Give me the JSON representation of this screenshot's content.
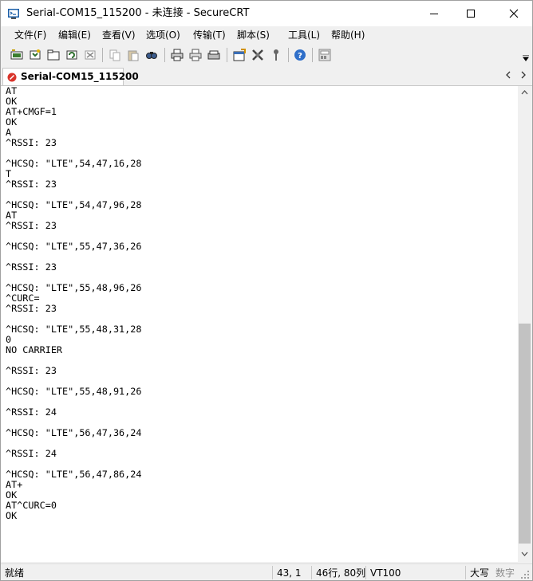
{
  "window": {
    "title": "Serial-COM15_115200 - 未连接 - SecureCRT"
  },
  "menu": {
    "items": [
      {
        "label": "文件(F)"
      },
      {
        "label": "编辑(E)"
      },
      {
        "label": "查看(V)"
      },
      {
        "label": "选项(O)"
      },
      {
        "label": "传输(T)"
      },
      {
        "label": "脚本(S)"
      },
      {
        "label": "工具(L)"
      },
      {
        "label": "帮助(H)"
      }
    ]
  },
  "toolbar": {
    "buttons": [
      "connect-icon",
      "quick-connect-icon",
      "connect-in-tab-icon",
      "reconnect-icon",
      "disconnect-icon",
      "copy-icon",
      "paste-icon",
      "find-icon",
      "print-icon",
      "print-selection-icon",
      "print-setup-icon",
      "session-options-icon",
      "global-options-icon",
      "keymap-icon",
      "help-icon",
      "keypad-icon"
    ]
  },
  "tab": {
    "label": "Serial-COM15_115200",
    "status_color": "#d9342b"
  },
  "terminal": {
    "lines": [
      "AT",
      "OK",
      "AT+CMGF=1",
      "OK",
      "A",
      "^RSSI: 23",
      "",
      "^HCSQ: \"LTE\",54,47,16,28",
      "T",
      "^RSSI: 23",
      "",
      "^HCSQ: \"LTE\",54,47,96,28",
      "AT",
      "^RSSI: 23",
      "",
      "^HCSQ: \"LTE\",55,47,36,26",
      "",
      "^RSSI: 23",
      "",
      "^HCSQ: \"LTE\",55,48,96,26",
      "^CURC=",
      "^RSSI: 23",
      "",
      "^HCSQ: \"LTE\",55,48,31,28",
      "0",
      "NO CARRIER",
      "",
      "^RSSI: 23",
      "",
      "^HCSQ: \"LTE\",55,48,91,26",
      "",
      "^RSSI: 24",
      "",
      "^HCSQ: \"LTE\",56,47,36,24",
      "",
      "^RSSI: 24",
      "",
      "^HCSQ: \"LTE\",56,47,86,24",
      "AT+",
      "OK",
      "AT^CURC=0",
      "OK"
    ]
  },
  "status": {
    "ready": "就绪",
    "cursor": "43,  1",
    "size": "46行, 80列",
    "emulation": "VT100",
    "caps": "大写",
    "num": "数字"
  }
}
